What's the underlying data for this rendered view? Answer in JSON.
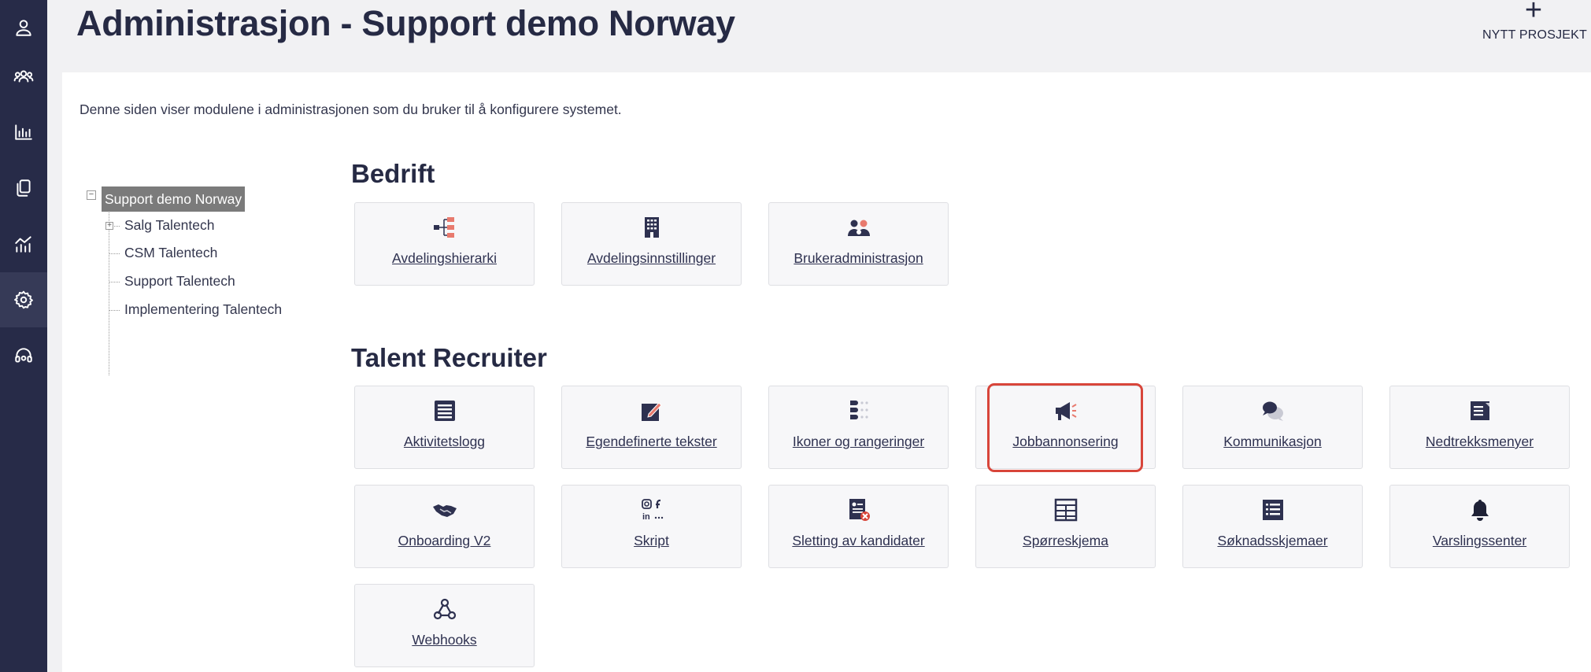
{
  "header": {
    "title": "Administrasjon - Support demo Norway",
    "new_project_label": "NYTT PROSJEKT"
  },
  "intro_text": "Denne siden viser modulene i administrasjonen som du bruker til å konfigurere systemet.",
  "sidebar": {
    "icons": [
      "user-icon",
      "team-icon",
      "bar-chart-icon",
      "documents-icon",
      "analytics-icon",
      "settings-icon",
      "support-headset-icon"
    ],
    "active_index": 5
  },
  "tree": {
    "root": "Support demo Norway",
    "children": [
      "Salg Talentech",
      "CSM Talentech",
      "Support Talentech",
      "Implementering Talentech"
    ]
  },
  "sections": {
    "bedrift": {
      "title": "Bedrift",
      "tiles": [
        {
          "label": "Avdelingshierarki",
          "icon": "hierarchy-icon"
        },
        {
          "label": "Avdelingsinnstillinger",
          "icon": "building-icon"
        },
        {
          "label": "Brukeradministrasjon",
          "icon": "users-admin-icon"
        }
      ]
    },
    "talent_recruiter": {
      "title": "Talent Recruiter",
      "tiles": [
        {
          "label": "Aktivitetslogg",
          "icon": "list-icon"
        },
        {
          "label": "Egendefinerte tekster",
          "icon": "edit-text-icon"
        },
        {
          "label": "Ikoner og rangeringer",
          "icon": "ranking-icon"
        },
        {
          "label": "Jobbannonsering",
          "icon": "megaphone-icon"
        },
        {
          "label": "Kommunikasjon",
          "icon": "chat-bubbles-icon"
        },
        {
          "label": "Nedtrekksmenyer",
          "icon": "dropdown-menu-icon"
        },
        {
          "label": "Onboarding V2",
          "icon": "handshake-icon"
        },
        {
          "label": "Skript",
          "icon": "social-media-icon"
        },
        {
          "label": "Sletting av kandidater",
          "icon": "delete-candidate-icon"
        },
        {
          "label": "Spørreskjema",
          "icon": "table-icon"
        },
        {
          "label": "Søknadsskjemaer",
          "icon": "form-list-icon"
        },
        {
          "label": "Varslingssenter",
          "icon": "bell-icon"
        },
        {
          "label": "Webhooks",
          "icon": "webhook-icon"
        }
      ]
    }
  },
  "colors": {
    "sidebar_bg": "#272b48",
    "sidebar_active": "#363a57",
    "text_primary": "#262a44",
    "highlight": "#d8453a",
    "icon_accent": "#e87a6e",
    "icon_dark": "#2e3150"
  }
}
